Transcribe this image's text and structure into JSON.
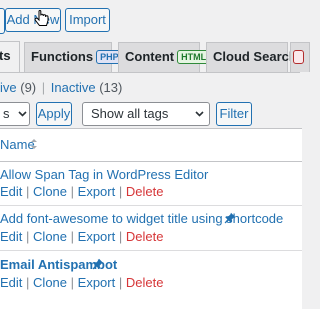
{
  "top_buttons": {
    "add_new": "Add New",
    "import": "Import"
  },
  "tabs": [
    {
      "label": "ts",
      "badge": ""
    },
    {
      "label": "Functions",
      "badge": "PHP"
    },
    {
      "label": "Content",
      "badge": "HTML"
    },
    {
      "label": "Cloud Search",
      "badge": ""
    }
  ],
  "filters": {
    "active_label": "ive",
    "active_count": "(9)",
    "separator": "|",
    "inactive_label": "Inactive",
    "inactive_count": "(13)"
  },
  "bulk": {
    "select_value": "s",
    "apply_label": "Apply"
  },
  "tag_filter": {
    "select_value": "Show all tags",
    "filter_label": "Filter"
  },
  "table": {
    "name_header": "Name",
    "rows": [
      {
        "title": "Allow Span Tag in WordPress Editor",
        "bold": false,
        "pinned": false
      },
      {
        "title": "Add font-awesome to widget title using shortcode",
        "bold": false,
        "pinned": true
      },
      {
        "title": "Email Antispambot",
        "bold": true,
        "pinned": true
      }
    ],
    "actions": {
      "edit": "Edit",
      "clone": "Clone",
      "export": "Export",
      "delete": "Delete",
      "sep": "|"
    }
  },
  "colors": {
    "link": "#2271b1",
    "delete": "#d63638",
    "background": "#f0f0f1"
  }
}
